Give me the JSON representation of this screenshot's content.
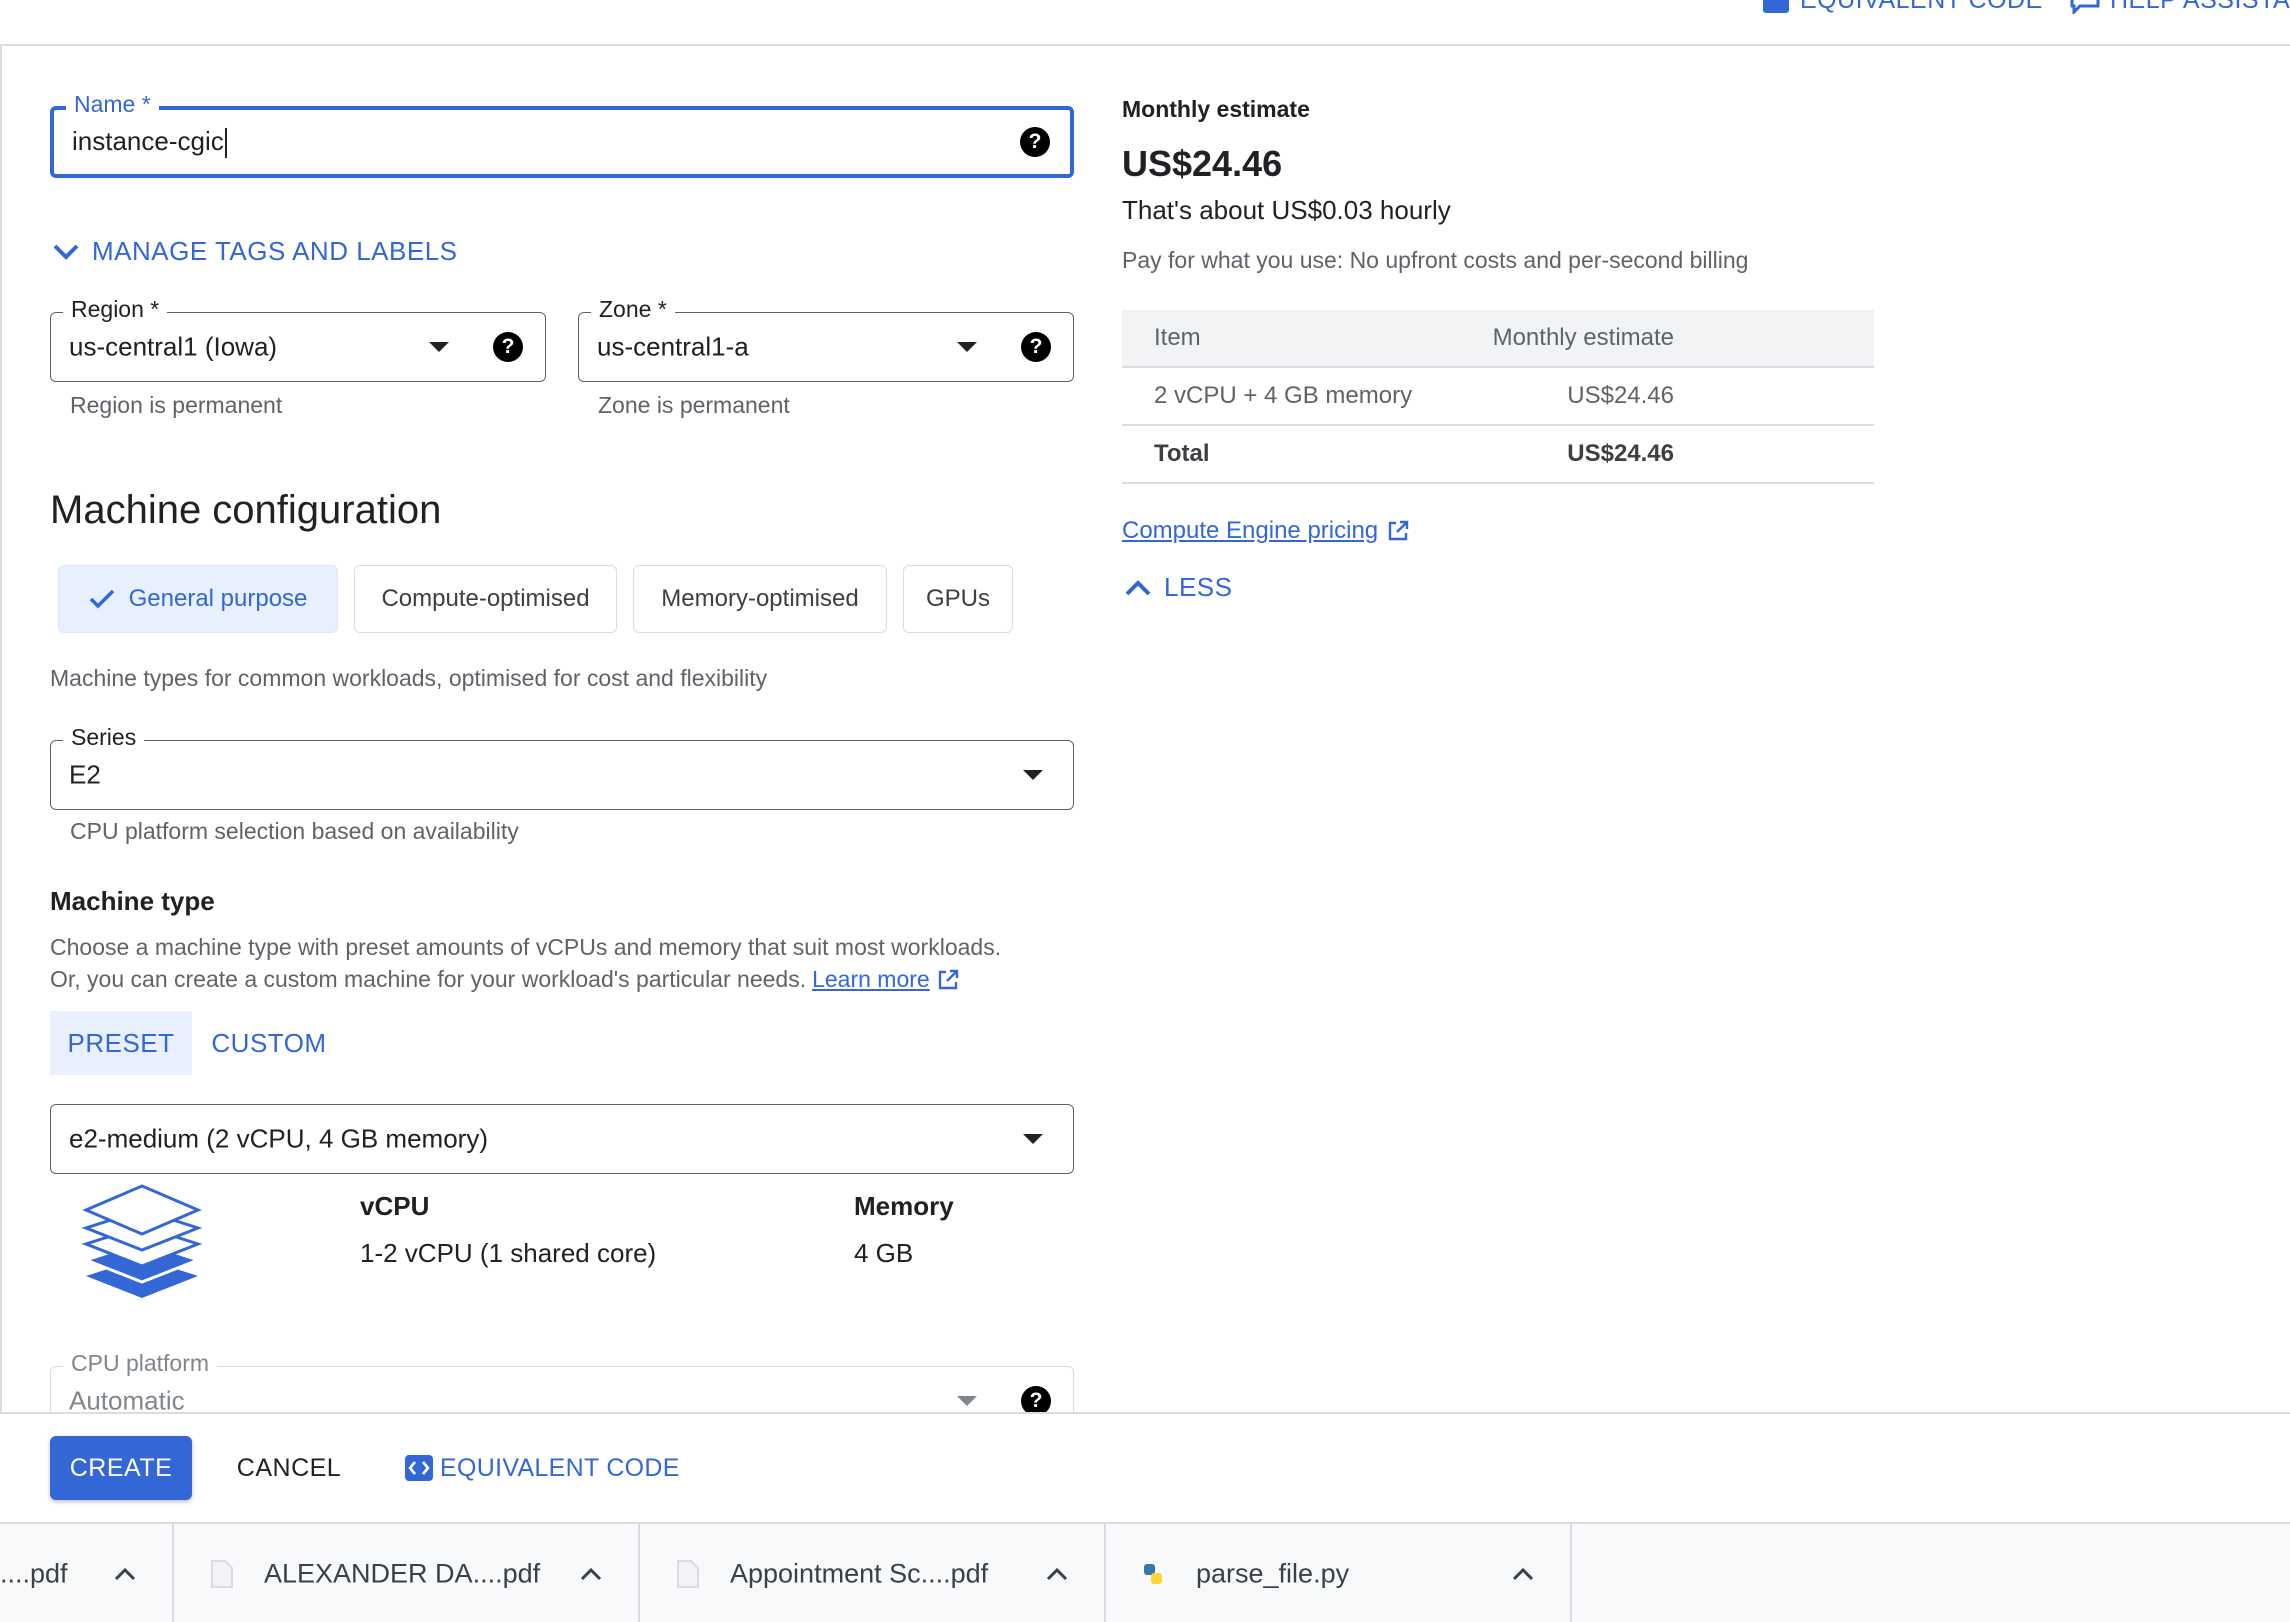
{
  "top_bar": {
    "equivalent_code_label": "EQUIVALENT CODE",
    "help_assistant_label": "HELP ASSISTANT"
  },
  "name_field": {
    "label": "Name *",
    "value": "instance-cgic"
  },
  "manage_tags_label": "MANAGE TAGS AND LABELS",
  "region_field": {
    "label": "Region *",
    "value": "us-central1 (Iowa)",
    "hint": "Region is permanent"
  },
  "zone_field": {
    "label": "Zone *",
    "value": "us-central1-a",
    "hint": "Zone is permanent"
  },
  "machine_configuration": {
    "title": "Machine configuration",
    "chips": [
      {
        "label": "General purpose",
        "selected": true
      },
      {
        "label": "Compute-optimised",
        "selected": false
      },
      {
        "label": "Memory-optimised",
        "selected": false
      },
      {
        "label": "GPUs",
        "selected": false
      }
    ],
    "description": "Machine types for common workloads, optimised for cost and flexibility"
  },
  "series_field": {
    "label": "Series",
    "value": "E2",
    "hint": "CPU platform selection based on availability"
  },
  "machine_type": {
    "title": "Machine type",
    "description_line1": "Choose a machine type with preset amounts of vCPUs and memory that suit most workloads.",
    "description_line2": "Or, you can create a custom machine for your workload's particular needs.",
    "learn_more": "Learn more",
    "tabs": [
      {
        "label": "PRESET",
        "active": true
      },
      {
        "label": "CUSTOM",
        "active": false
      }
    ],
    "selected": "e2-medium (2 vCPU, 4 GB memory)",
    "vcpu_heading": "vCPU",
    "vcpu_value": "1-2 vCPU (1 shared core)",
    "memory_heading": "Memory",
    "memory_value": "4 GB"
  },
  "cpu_platform_field": {
    "label": "CPU platform",
    "value": "Automatic"
  },
  "estimate": {
    "label": "Monthly estimate",
    "price": "US$24.46",
    "hourly": "That's about US$0.03 hourly",
    "note": "Pay for what you use: No upfront costs and per-second billing",
    "table_headers": [
      "Item",
      "Monthly estimate"
    ],
    "rows": [
      {
        "item": "2 vCPU + 4 GB memory",
        "cost": "US$24.46"
      }
    ],
    "total_label": "Total",
    "total_value": "US$24.46",
    "pricing_link": "Compute Engine pricing",
    "less_label": "LESS"
  },
  "actions": {
    "create": "CREATE",
    "cancel": "CANCEL",
    "equivalent_code": "EQUIVALENT CODE"
  },
  "downloads": [
    {
      "name": "....pdf",
      "icon": "pdf-file-icon"
    },
    {
      "name": "ALEXANDER DA....pdf",
      "icon": "file-icon"
    },
    {
      "name": "Appointment Sc....pdf",
      "icon": "file-icon"
    },
    {
      "name": "parse_file.py",
      "icon": "python-file-icon"
    }
  ],
  "colors": {
    "accent": "#3367d6",
    "chip_selected_bg": "#e8f0fe",
    "text_primary": "#202124",
    "text_secondary": "#5f6368",
    "border": "#dadce0"
  }
}
